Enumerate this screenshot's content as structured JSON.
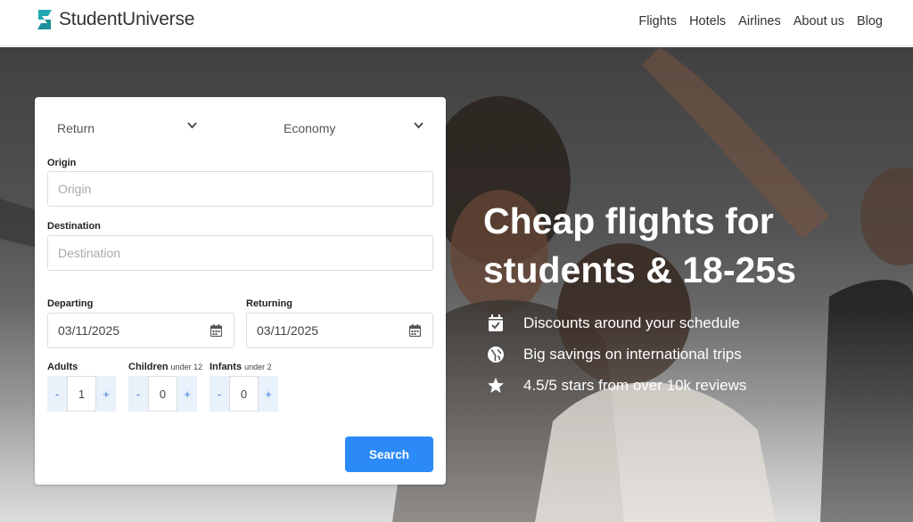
{
  "brand": {
    "name": "StudentUniverse",
    "accent": "#22a8b5"
  },
  "nav": {
    "items": [
      "Flights",
      "Hotels",
      "Airlines",
      "About us",
      "Blog"
    ]
  },
  "search": {
    "trip_type": "Return",
    "cabin": "Economy",
    "origin": {
      "label": "Origin",
      "placeholder": "Origin"
    },
    "destination": {
      "label": "Destination",
      "placeholder": "Destination"
    },
    "departing": {
      "label": "Departing",
      "value": "03/11/2025"
    },
    "returning": {
      "label": "Returning",
      "value": "03/11/2025"
    },
    "adults": {
      "label": "Adults",
      "sub": "",
      "value": "1",
      "minus": "-",
      "plus": "+"
    },
    "children": {
      "label": "Children",
      "sub": "under 12",
      "value": "0",
      "minus": "-",
      "plus": "+"
    },
    "infants": {
      "label": "Infants",
      "sub": "under 2",
      "value": "0",
      "minus": "-",
      "plus": "+"
    },
    "button_label": "Search",
    "button_color": "#2b8af7"
  },
  "hero": {
    "headline": "Cheap flights for students & 18-25s",
    "features": [
      {
        "icon": "calendar-check-icon",
        "text": "Discounts around your schedule"
      },
      {
        "icon": "globe-icon",
        "text": "Big savings on international trips"
      },
      {
        "icon": "star-icon",
        "text": "4.5/5 stars from over 10k reviews"
      }
    ]
  }
}
